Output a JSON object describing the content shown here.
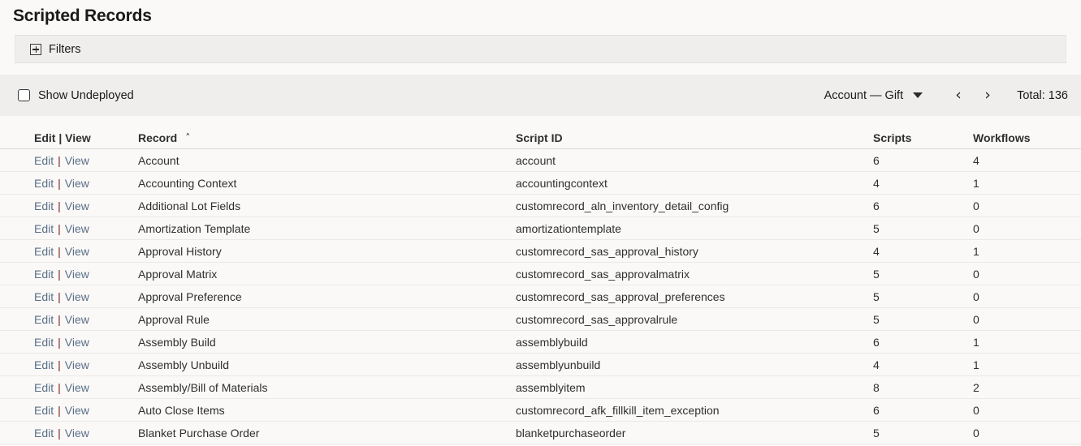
{
  "page": {
    "title": "Scripted Records"
  },
  "filters": {
    "label": "Filters",
    "expand_icon": "plus-box-icon"
  },
  "toolbar": {
    "show_undeployed_label": "Show Undeployed",
    "show_undeployed_checked": false,
    "view_select_value": "Account — Gift",
    "dropdown_icon": "chevron-down-icon",
    "prev_label": "‹",
    "next_label": "›",
    "total_label": "Total: 136"
  },
  "table": {
    "headers": {
      "actions": "Edit | View",
      "record": "Record",
      "script_id": "Script ID",
      "scripts": "Scripts",
      "workflows": "Workflows"
    },
    "sort": {
      "column": "Record",
      "direction_icon": "caret-up-icon",
      "caret": "˄"
    },
    "row_actions": {
      "edit": "Edit",
      "separator": "|",
      "view": "View"
    },
    "rows": [
      {
        "record": "Account",
        "script_id": "account",
        "scripts": "6",
        "workflows": "4"
      },
      {
        "record": "Accounting Context",
        "script_id": "accountingcontext",
        "scripts": "4",
        "workflows": "1"
      },
      {
        "record": "Additional Lot Fields",
        "script_id": "customrecord_aln_inventory_detail_config",
        "scripts": "6",
        "workflows": "0"
      },
      {
        "record": "Amortization Template",
        "script_id": "amortizationtemplate",
        "scripts": "5",
        "workflows": "0"
      },
      {
        "record": "Approval History",
        "script_id": "customrecord_sas_approval_history",
        "scripts": "4",
        "workflows": "1"
      },
      {
        "record": "Approval Matrix",
        "script_id": "customrecord_sas_approvalmatrix",
        "scripts": "5",
        "workflows": "0"
      },
      {
        "record": "Approval Preference",
        "script_id": "customrecord_sas_approval_preferences",
        "scripts": "5",
        "workflows": "0"
      },
      {
        "record": "Approval Rule",
        "script_id": "customrecord_sas_approvalrule",
        "scripts": "5",
        "workflows": "0"
      },
      {
        "record": "Assembly Build",
        "script_id": "assemblybuild",
        "scripts": "6",
        "workflows": "1"
      },
      {
        "record": "Assembly Unbuild",
        "script_id": "assemblyunbuild",
        "scripts": "4",
        "workflows": "1"
      },
      {
        "record": "Assembly/Bill of Materials",
        "script_id": "assemblyitem",
        "scripts": "8",
        "workflows": "2"
      },
      {
        "record": "Auto Close Items",
        "script_id": "customrecord_afk_fillkill_item_exception",
        "scripts": "6",
        "workflows": "0"
      },
      {
        "record": "Blanket Purchase Order",
        "script_id": "blanketpurchaseorder",
        "scripts": "5",
        "workflows": "0"
      }
    ]
  },
  "colors": {
    "page_background": "#faf9f8",
    "band_background": "#efeeed",
    "link": "#5a6f86",
    "separator": "#7a2020",
    "text": "#1a1a1a",
    "row_border": "#ebe9e7"
  }
}
